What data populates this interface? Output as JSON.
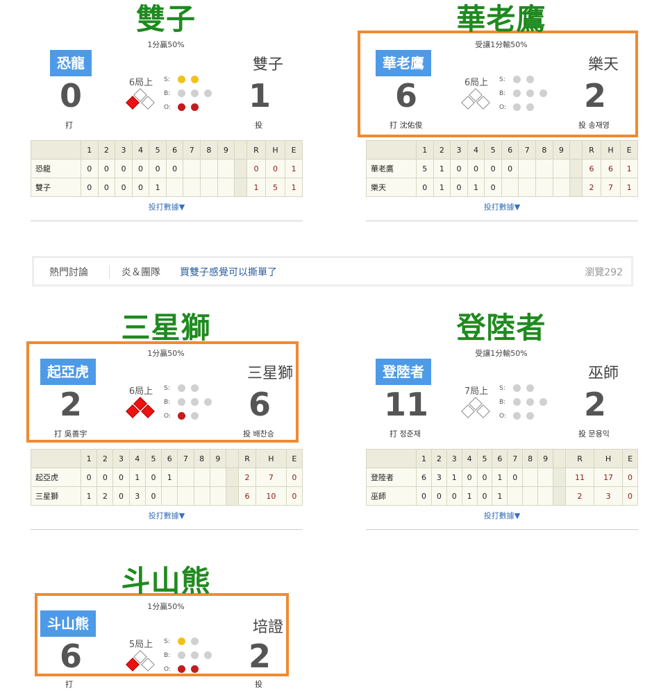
{
  "hot_topics": {
    "label": "熱門討論",
    "tag": "炎＆團隊",
    "title": "買雙子感覺可以撕單了",
    "views": "瀏覽292"
  },
  "box_link": "投打數據▼",
  "count_labels": {
    "s": "S:",
    "b": "B:",
    "o": "O:"
  },
  "games": [
    {
      "title": "雙子",
      "handicap": "1分贏50%",
      "away": "恐龍",
      "home": "雙子",
      "away_score": "0",
      "home_score": "1",
      "away_player": "打",
      "home_player": "投",
      "inning": "6局上",
      "bases": [
        false,
        false,
        true
      ],
      "strikes": 2,
      "balls": 0,
      "outs": 2,
      "highlighted": false,
      "linescore": {
        "header": [
          "",
          "1",
          "2",
          "3",
          "4",
          "5",
          "6",
          "7",
          "8",
          "9",
          "",
          "R",
          "H",
          "E"
        ],
        "rows": [
          {
            "team": "恐龍",
            "innings": [
              "0",
              "0",
              "0",
              "0",
              "0",
              "0",
              "",
              "",
              ""
            ],
            "rhe": [
              "0",
              "0",
              "1"
            ]
          },
          {
            "team": "雙子",
            "innings": [
              "0",
              "0",
              "0",
              "0",
              "1",
              "",
              "",
              "",
              ""
            ],
            "rhe": [
              "1",
              "5",
              "1"
            ]
          }
        ]
      }
    },
    {
      "title": "華老鷹",
      "handicap": "受讓1分輸50%",
      "away": "華老鷹",
      "home": "樂天",
      "away_score": "6",
      "home_score": "2",
      "away_player": "打 沈佑俊",
      "home_player": "投 송재영",
      "inning": "6局上",
      "bases": [
        false,
        false,
        false
      ],
      "strikes": 0,
      "balls": 0,
      "outs": 0,
      "highlighted": true,
      "linescore": {
        "header": [
          "",
          "1",
          "2",
          "3",
          "4",
          "5",
          "6",
          "7",
          "8",
          "9",
          "",
          "R",
          "H",
          "E"
        ],
        "rows": [
          {
            "team": "華老鷹",
            "innings": [
              "5",
              "1",
              "0",
              "0",
              "0",
              "0",
              "",
              "",
              ""
            ],
            "rhe": [
              "6",
              "6",
              "1"
            ]
          },
          {
            "team": "樂天",
            "innings": [
              "0",
              "1",
              "0",
              "1",
              "0",
              "",
              "",
              "",
              ""
            ],
            "rhe": [
              "2",
              "7",
              "1"
            ]
          }
        ]
      }
    },
    {
      "title": "三星獅",
      "handicap": "1分贏50%",
      "away": "起亞虎",
      "home": "三星獅",
      "away_score": "2",
      "home_score": "6",
      "away_player": "打 吳善宇",
      "home_player": "投 배찬승",
      "inning": "6局上",
      "bases": [
        true,
        true,
        false
      ],
      "strikes": 0,
      "balls": 0,
      "outs": 1,
      "highlighted": true,
      "linescore": {
        "header": [
          "",
          "1",
          "2",
          "3",
          "4",
          "5",
          "6",
          "7",
          "8",
          "9",
          "",
          "R",
          "H",
          "E"
        ],
        "rows": [
          {
            "team": "起亞虎",
            "innings": [
              "0",
              "0",
              "0",
              "1",
              "0",
              "1",
              "",
              "",
              ""
            ],
            "rhe": [
              "2",
              "7",
              "0"
            ]
          },
          {
            "team": "三星獅",
            "innings": [
              "1",
              "2",
              "0",
              "3",
              "0",
              "",
              "",
              "",
              ""
            ],
            "rhe": [
              "6",
              "10",
              "0"
            ]
          }
        ]
      }
    },
    {
      "title": "登陸者",
      "handicap": "受讓1分輸50%",
      "away": "登陸者",
      "home": "巫師",
      "away_score": "11",
      "home_score": "2",
      "away_player": "打 정준재",
      "home_player": "投 문용익",
      "inning": "7局上",
      "bases": [
        false,
        false,
        false
      ],
      "strikes": 0,
      "balls": 0,
      "outs": 0,
      "highlighted": false,
      "linescore": {
        "header": [
          "",
          "1",
          "2",
          "3",
          "4",
          "5",
          "6",
          "7",
          "8",
          "9",
          "",
          "R",
          "H",
          "E"
        ],
        "rows": [
          {
            "team": "登陸者",
            "innings": [
              "6",
              "3",
              "1",
              "0",
              "0",
              "1",
              "0",
              "",
              ""
            ],
            "rhe": [
              "11",
              "17",
              "0"
            ]
          },
          {
            "team": "巫師",
            "innings": [
              "0",
              "0",
              "0",
              "1",
              "0",
              "1",
              "",
              "",
              ""
            ],
            "rhe": [
              "2",
              "3",
              "0"
            ]
          }
        ]
      }
    },
    {
      "title": "斗山熊",
      "handicap": "1分贏50%",
      "away": "斗山熊",
      "home": "培證",
      "away_score": "6",
      "home_score": "2",
      "away_player": "打",
      "home_player": "投",
      "inning": "5局上",
      "bases": [
        false,
        false,
        true
      ],
      "strikes": 1,
      "balls": 0,
      "outs": 2,
      "highlighted": true
    }
  ]
}
